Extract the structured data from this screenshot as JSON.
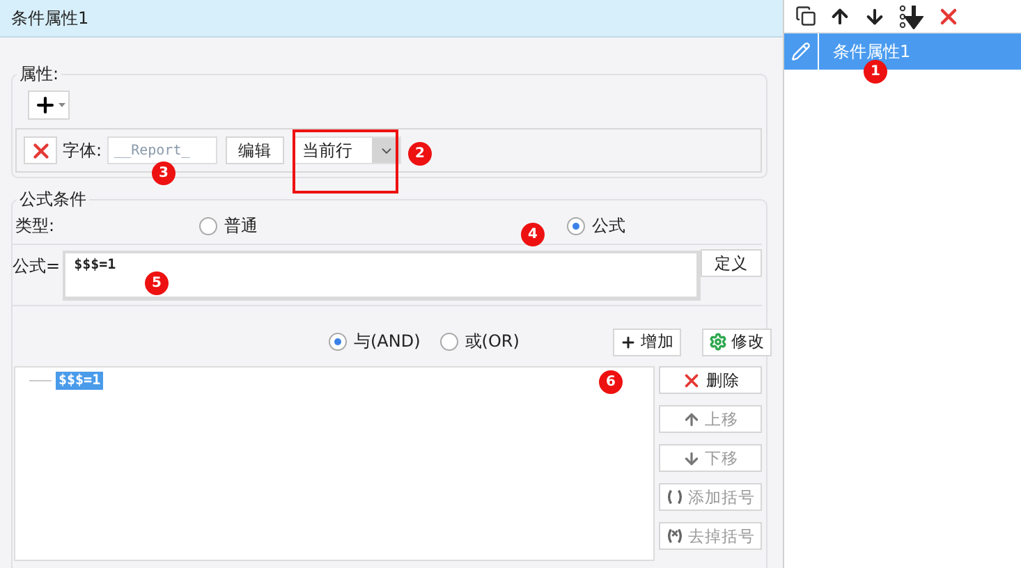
{
  "title": "条件属性1",
  "condition_list": [
    {
      "label": "条件属性1",
      "selected": true
    }
  ],
  "properties": {
    "legend": "属性:",
    "font_row": {
      "label": "字体:",
      "value": "__Report_",
      "edit_button": "编辑",
      "scope": "当前行"
    }
  },
  "formula_condition": {
    "legend": "公式条件",
    "type_label": "类型:",
    "types": [
      {
        "label": "普通",
        "selected": false
      },
      {
        "label": "公式",
        "selected": true
      }
    ],
    "formula_label": "公式=",
    "formula": "$$$=1",
    "define_button": "定义",
    "logic": [
      {
        "label": "与(AND)",
        "selected": true
      },
      {
        "label": "或(OR)",
        "selected": false
      }
    ],
    "add_button": "增加",
    "modify_button": "修改",
    "conditions": [
      {
        "text": "$$$=1",
        "selected": true
      }
    ],
    "actions": [
      {
        "kind": "delete",
        "label": "删除",
        "disabled": false
      },
      {
        "kind": "up",
        "label": "上移",
        "disabled": true
      },
      {
        "kind": "down",
        "label": "下移",
        "disabled": true
      },
      {
        "kind": "add_paren",
        "label": "添加括号",
        "disabled": true
      },
      {
        "kind": "remove_paren",
        "label": "去掉括号",
        "disabled": true
      }
    ]
  },
  "markers": [
    "1",
    "2",
    "3",
    "4",
    "5",
    "6"
  ]
}
